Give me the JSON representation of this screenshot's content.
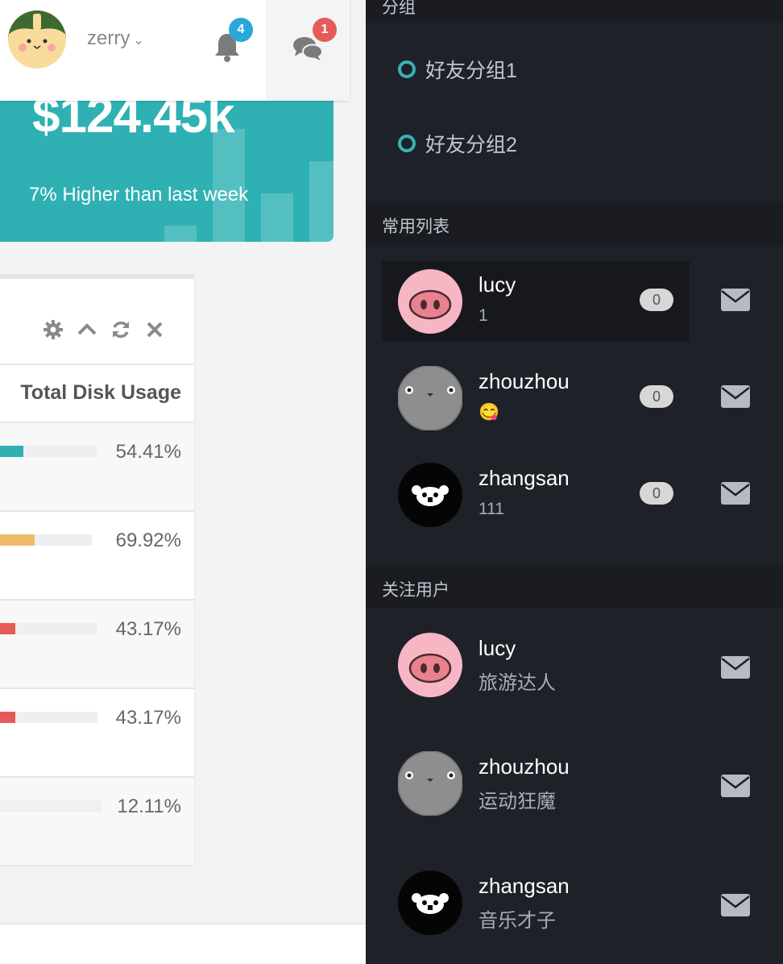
{
  "header": {
    "username": "zerry",
    "notifications_count": "4",
    "messages_count": "1"
  },
  "stat_card": {
    "value": "$124.45k",
    "note": "7% Higher than last week"
  },
  "disk_panel": {
    "column_header": "Total Disk Usage",
    "rows": [
      {
        "percent": "54.41%",
        "value": 54.41,
        "color": "#2fb1b3"
      },
      {
        "percent": "69.92%",
        "value": 69.92,
        "color": "#f0bc6a"
      },
      {
        "percent": "43.17%",
        "value": 43.17,
        "color": "#e55b57"
      },
      {
        "percent": "43.17%",
        "value": 43.17,
        "color": "#e55b57"
      },
      {
        "percent": "12.11%",
        "value": 12.11,
        "color": "#cfcfcf"
      }
    ]
  },
  "sidebar": {
    "groups_head": "分组",
    "groups": [
      {
        "label": "好友分组1"
      },
      {
        "label": "好友分组2"
      }
    ],
    "recent_head": "常用列表",
    "recent": [
      {
        "name": "lucy",
        "sub": "1",
        "count": "0",
        "avatar": "pig"
      },
      {
        "name": "zhouzhou",
        "sub": "😋",
        "count": "0",
        "avatar": "gray-face"
      },
      {
        "name": "zhangsan",
        "sub": "111",
        "count": "0",
        "avatar": "bear"
      }
    ],
    "follow_head": "关注用户",
    "follow": [
      {
        "name": "lucy",
        "sub": "旅游达人",
        "avatar": "pig"
      },
      {
        "name": "zhouzhou",
        "sub": "运动狂魔",
        "avatar": "gray-face"
      },
      {
        "name": "zhangsan",
        "sub": "音乐才子",
        "avatar": "bear"
      }
    ]
  },
  "colors": {
    "accent": "#2fb1b3",
    "sidebar_bg": "#1f2129",
    "badge_blue": "#2aa8d9",
    "badge_red": "#e55b57"
  }
}
